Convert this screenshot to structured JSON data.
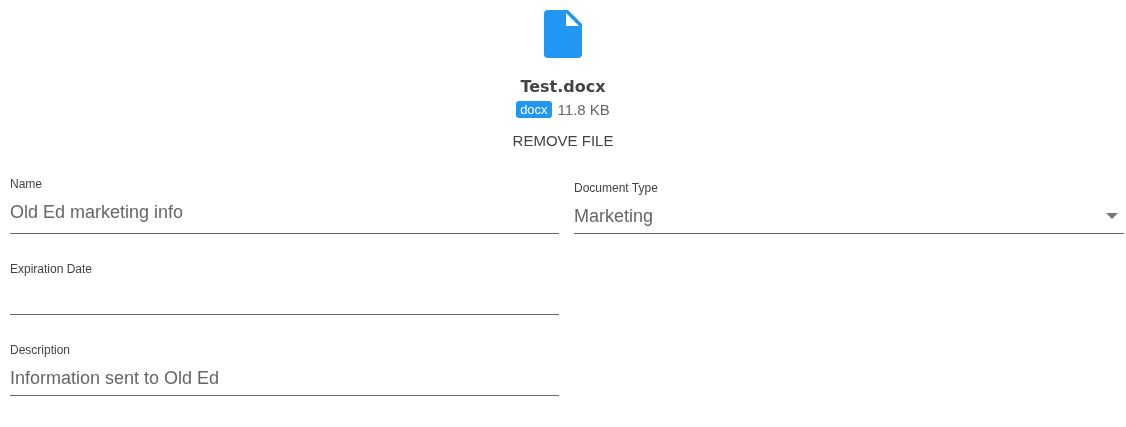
{
  "file": {
    "name": "Test.docx",
    "extension": "docx",
    "size": "11.8 KB",
    "remove_label": "REMOVE FILE"
  },
  "form_rows": [
    [
      {
        "kind": "text",
        "label": "Name",
        "value": "Old Ed marketing info"
      },
      {
        "kind": "select",
        "label": "Document Type",
        "value": "Marketing"
      }
    ],
    [
      {
        "kind": "text",
        "label": "Expiration Date"
      }
    ],
    [
      {
        "kind": "text",
        "label": "Description",
        "value": "Information sent to Old Ed"
      }
    ]
  ]
}
